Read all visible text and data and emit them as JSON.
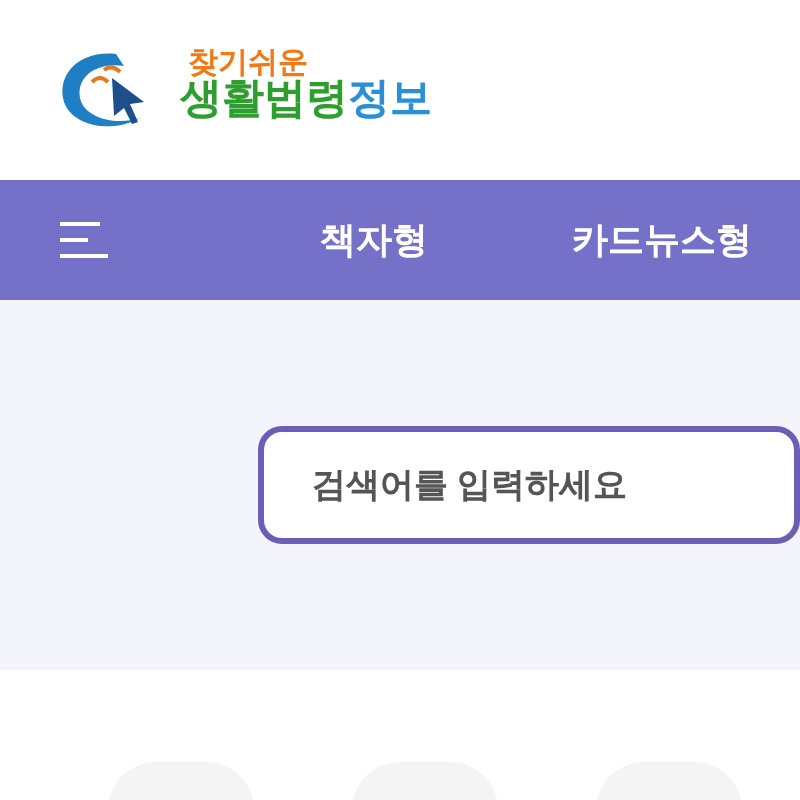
{
  "logo": {
    "tagline": "찾기쉬운",
    "title": [
      {
        "text": "생활법령",
        "color": "#2e9e2e"
      },
      {
        "text": "정보",
        "color": "#2a8fd6"
      }
    ]
  },
  "nav": {
    "items": [
      "책자형",
      "카드뉴스형"
    ]
  },
  "search": {
    "placeholder": "검색어를 입력하세요"
  }
}
